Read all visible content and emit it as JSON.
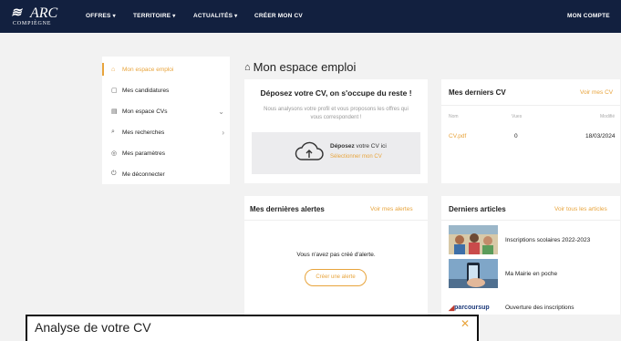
{
  "brand": {
    "mark": "≋",
    "name": "ARC",
    "city": "COMPIÈGNE"
  },
  "nav": {
    "offres": "OFFRES",
    "territoire": "TERRITOIRE",
    "actualites": "ACTUALITÉS",
    "creer_cv": "CRÉER MON CV",
    "mon_compte": "MON COMPTE",
    "caret": "▾"
  },
  "sidebar": {
    "items": [
      {
        "label": "Mon espace emploi",
        "icon": "⌂"
      },
      {
        "label": "Mes candidatures",
        "icon": "▢"
      },
      {
        "label": "Mon espace CVs",
        "icon": "▤",
        "chev": "⌄"
      },
      {
        "label": "Mes recherches",
        "icon": "⌕",
        "chev": "›"
      },
      {
        "label": "Mes paramètres",
        "icon": "◎"
      },
      {
        "label": "Me déconnecter",
        "icon": "⏻"
      }
    ]
  },
  "page": {
    "title": "Mon espace emploi",
    "icon": "⌂"
  },
  "cv_upload": {
    "headline": "Déposez votre CV, on s'occupe du reste !",
    "sub": "Nous analysons votre profil et vous proposons les offres qui vous correspondent !",
    "drop_bold": "Déposez",
    "drop_rest": "votre CV ici",
    "drop_select": "Sélectionner mon CV"
  },
  "last_cvs": {
    "title": "Mes derniers CV",
    "link": "Voir mes CV",
    "columns": [
      "Nom",
      "Vues",
      "Modifié"
    ],
    "rows": [
      {
        "name": "CV.pdf",
        "views": "0",
        "date": "18/03/2024"
      }
    ]
  },
  "alerts": {
    "title": "Mes dernières alertes",
    "link": "Voir mes alertes",
    "empty": "Vous n'avez pas créé d'alerte.",
    "create": "Créer une alerte"
  },
  "articles": {
    "title": "Derniers articles",
    "link": "Voir tous les articles",
    "items": [
      {
        "title": "Inscriptions scolaires 2022-2023"
      },
      {
        "title": "Ma Mairie en poche"
      },
      {
        "title": "Ouverture des inscriptions",
        "logo": "parcoursup"
      }
    ]
  },
  "modal": {
    "title": "Analyse de votre CV",
    "close": "✕"
  },
  "colors": {
    "nav": "#12203f",
    "accent": "#e8a43c",
    "bg": "#f2f2f2"
  }
}
